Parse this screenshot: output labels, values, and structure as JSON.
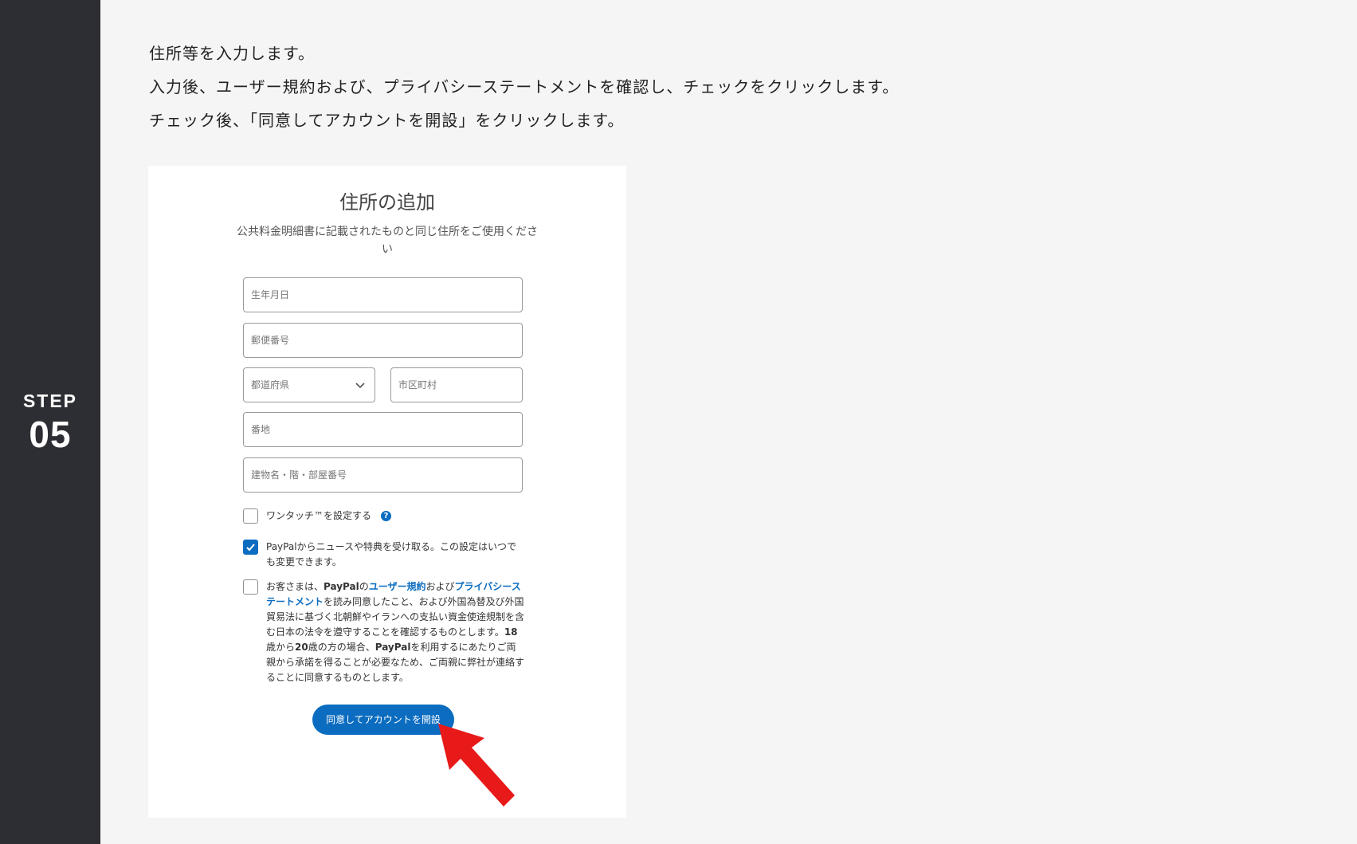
{
  "step": {
    "label": "STEP",
    "number": "05"
  },
  "instructions": [
    "住所等を入力します。",
    "入力後、ユーザー規約および、プライバシーステートメントを確認し、チェックをクリックします。",
    "チェック後、「同意してアカウントを開設」をクリックします。"
  ],
  "form": {
    "title": "住所の追加",
    "subtitle": "公共料金明細書に記載されたものと同じ住所をご使用ください",
    "birthdate_placeholder": "生年月日",
    "postal_placeholder": "郵便番号",
    "prefecture_label": "都道府県",
    "city_placeholder": "市区町村",
    "address_placeholder": "番地",
    "building_placeholder": "建物名・階・部屋番号",
    "onetouch": {
      "label": "ワンタッチ™を設定する",
      "checked": false,
      "help_icon": "?"
    },
    "news": {
      "label": "PayPalからニュースや特典を受け取る。この設定はいつでも変更できます。",
      "checked": true
    },
    "terms": {
      "checked": false,
      "prefix": "お客さまは、",
      "brand1": "PayPal",
      "of": "の",
      "user_agreement_link": "ユーザー規約",
      "and": "および",
      "privacy_link": "プライバシーステートメント",
      "middle": "を読み同意したこと、および外国為替及び外国貿易法に基づく北朝鮮やイランへの支払い資金使途規制を含む日本の法令を遵守することを確認するものとします。",
      "age": "18",
      "age_mid": "歳から",
      "age2": "20",
      "age_tail": "歳の方の場合、",
      "brand2": "PayPal",
      "rest": "を利用するにあたりご両親から承諾を得ることが必要なため、ご両親に弊社が連絡することに同意するものとします。"
    },
    "submit_label": "同意してアカウントを開設"
  },
  "colors": {
    "brand_blue": "#0b6cc0",
    "rail": "#2d2e33",
    "arrow": "#e81919"
  }
}
